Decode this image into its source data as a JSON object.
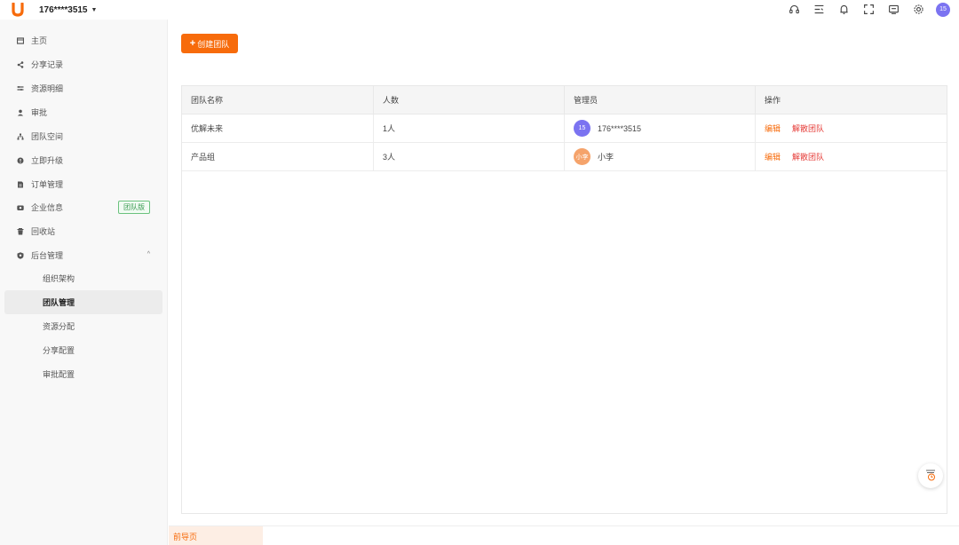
{
  "header": {
    "account": "176****3515",
    "avatar_text": "15",
    "icons": [
      "headset-icon",
      "list-icon",
      "bell-icon",
      "fullscreen-icon",
      "screen-icon",
      "settings-icon"
    ]
  },
  "sidebar": {
    "items": [
      {
        "label": "主页",
        "icon": "home-icon"
      },
      {
        "label": "分享记录",
        "icon": "share-icon"
      },
      {
        "label": "资源明细",
        "icon": "resource-icon"
      },
      {
        "label": "审批",
        "icon": "person-icon"
      },
      {
        "label": "团队空间",
        "icon": "team-icon"
      },
      {
        "label": "立即升级",
        "icon": "upgrade-icon"
      },
      {
        "label": "订单管理",
        "icon": "order-icon"
      },
      {
        "label": "企业信息",
        "icon": "company-icon",
        "badge": "团队版"
      },
      {
        "label": "回收站",
        "icon": "trash-icon"
      },
      {
        "label": "后台管理",
        "icon": "admin-icon"
      }
    ],
    "sub_items": [
      {
        "label": "组织架构"
      },
      {
        "label": "团队管理"
      },
      {
        "label": "资源分配"
      },
      {
        "label": "分享配置"
      },
      {
        "label": "审批配置"
      }
    ]
  },
  "main": {
    "create_button": "创建团队",
    "columns": [
      "团队名称",
      "人数",
      "管理员",
      "操作"
    ],
    "rows": [
      {
        "name": "优解未来",
        "count": "1人",
        "admin_avatar": "15",
        "admin_avatar_color": "#7b73f1",
        "admin": "176****3515",
        "edit": "编辑",
        "dissolve": "解散团队"
      },
      {
        "name": "产品组",
        "count": "3人",
        "admin_avatar": "小李",
        "admin_avatar_color": "#f5a36b",
        "admin": "小李",
        "edit": "编辑",
        "dissolve": "解散团队"
      }
    ]
  },
  "footer": {
    "tab": "前导页"
  },
  "colors": {
    "accent": "#f76b0b",
    "danger": "#e53935"
  }
}
